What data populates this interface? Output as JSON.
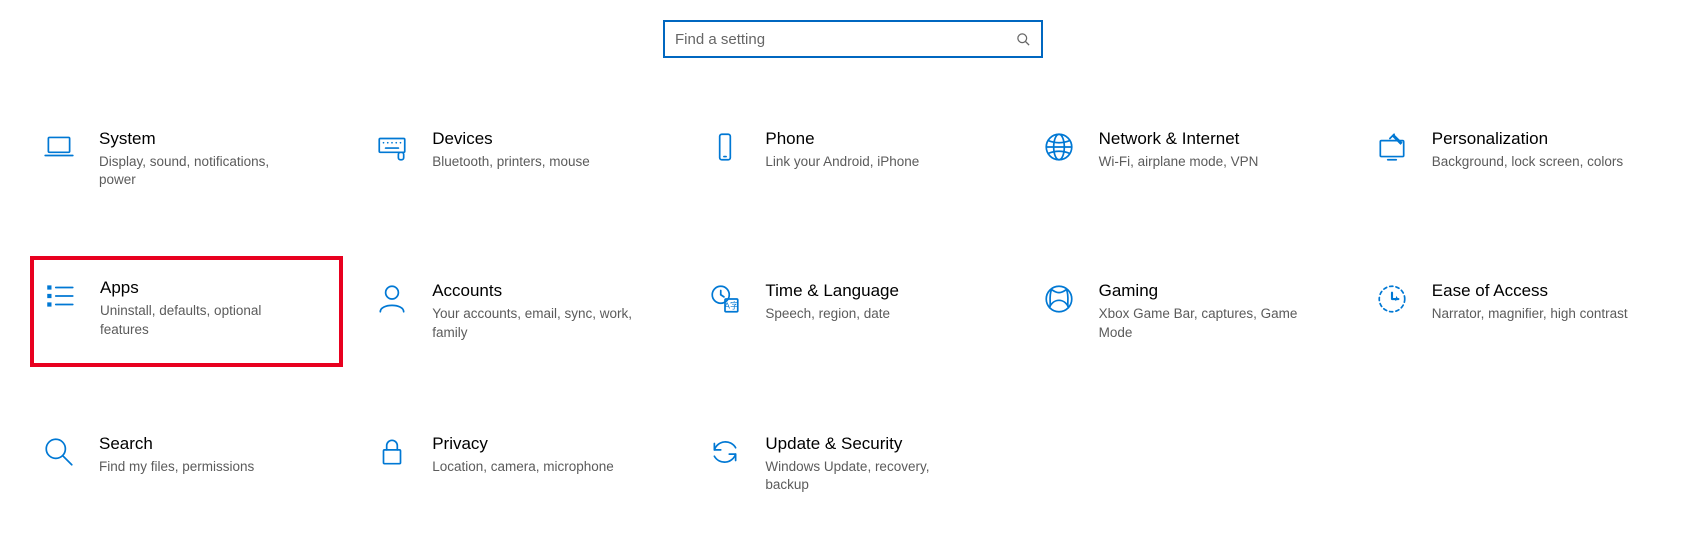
{
  "search": {
    "placeholder": "Find a setting"
  },
  "categories": [
    {
      "title": "System",
      "desc": "Display, sound, notifications, power",
      "icon": "laptop",
      "highlight": false
    },
    {
      "title": "Devices",
      "desc": "Bluetooth, printers, mouse",
      "icon": "keyboard",
      "highlight": false
    },
    {
      "title": "Phone",
      "desc": "Link your Android, iPhone",
      "icon": "phone",
      "highlight": false
    },
    {
      "title": "Network & Internet",
      "desc": "Wi-Fi, airplane mode, VPN",
      "icon": "globe",
      "highlight": false
    },
    {
      "title": "Personalization",
      "desc": "Background, lock screen, colors",
      "icon": "pen-monitor",
      "highlight": false
    },
    {
      "title": "Apps",
      "desc": "Uninstall, defaults, optional features",
      "icon": "apps-list",
      "highlight": true
    },
    {
      "title": "Accounts",
      "desc": "Your accounts, email, sync, work, family",
      "icon": "person",
      "highlight": false
    },
    {
      "title": "Time & Language",
      "desc": "Speech, region, date",
      "icon": "time-language",
      "highlight": false
    },
    {
      "title": "Gaming",
      "desc": "Xbox Game Bar, captures, Game Mode",
      "icon": "xbox",
      "highlight": false
    },
    {
      "title": "Ease of Access",
      "desc": "Narrator, magnifier, high contrast",
      "icon": "ease-access",
      "highlight": false
    },
    {
      "title": "Search",
      "desc": "Find my files, permissions",
      "icon": "search-big",
      "highlight": false
    },
    {
      "title": "Privacy",
      "desc": "Location, camera, microphone",
      "icon": "lock",
      "highlight": false
    },
    {
      "title": "Update & Security",
      "desc": "Windows Update, recovery, backup",
      "icon": "update",
      "highlight": false
    }
  ]
}
